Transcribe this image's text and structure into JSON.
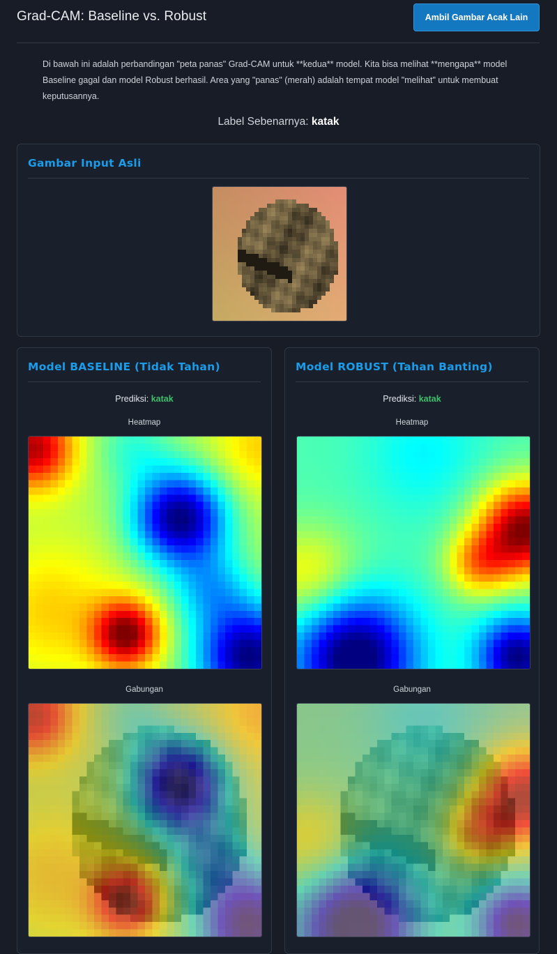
{
  "header": {
    "title": "Grad-CAM: Baseline vs. Robust",
    "random_button": "Ambil Gambar Acak Lain"
  },
  "intro": "Di bawah ini adalah perbandingan \"peta panas\" Grad-CAM untuk **kedua** model. Kita bisa melihat **mengapa** model Baseline gagal dan model Robust berhasil. Area yang \"panas\" (merah) adalah tempat model \"melihat\" untuk membuat keputusannya.",
  "true_label": {
    "prefix": "Label Sebenarnya:",
    "value": "katak"
  },
  "input_card": {
    "title": "Gambar Input Asli"
  },
  "baseline": {
    "title": "Model BASELINE (Tidak Tahan)",
    "pred_prefix": "Prediksi:",
    "pred_value": "katak",
    "heatmap_caption": "Heatmap",
    "overlay_caption": "Gabungan"
  },
  "robust": {
    "title": "Model ROBUST (Tahan Banting)",
    "pred_prefix": "Prediksi:",
    "pred_value": "katak",
    "heatmap_caption": "Heatmap",
    "overlay_caption": "Gabungan"
  },
  "colors": {
    "accent": "#1b9be8",
    "button": "#1478c0",
    "prediction": "#3fbf6a",
    "background": "#171c26"
  }
}
